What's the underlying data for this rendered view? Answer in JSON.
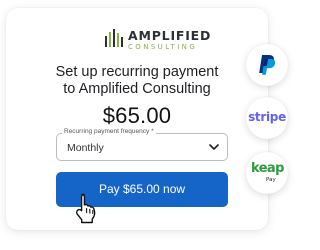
{
  "brand": {
    "name": "AMPLIFIED",
    "sub": "CONSULTING",
    "color_dark": "#2d3134",
    "color_green": "#8ab245"
  },
  "checkout": {
    "heading_line1": "Set up recurring payment",
    "heading_line2": "to Amplified Consulting",
    "amount": "$65.00",
    "frequency_label": "Recurring payment frequency *",
    "frequency_value": "Monthly",
    "pay_button": "Pay $65.00 now",
    "accent_color": "#1565c8"
  },
  "providers": {
    "paypal": {
      "icon": "paypal-logo"
    },
    "stripe": {
      "label": "stripe",
      "color": "#6461f0"
    },
    "keap": {
      "label": "keap",
      "sub": "Pay",
      "color": "#2a9d3c"
    }
  }
}
